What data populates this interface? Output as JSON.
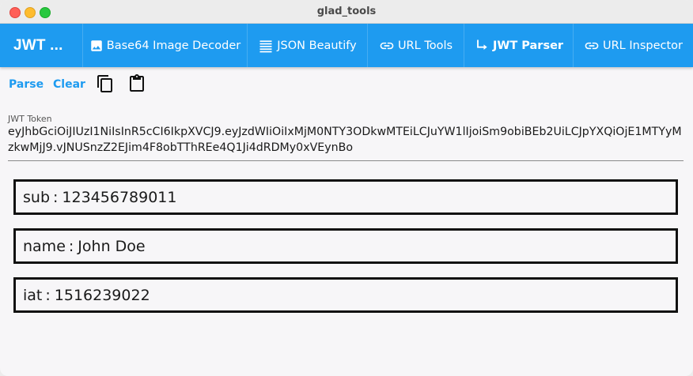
{
  "window": {
    "title": "glad_tools"
  },
  "appbar": {
    "title": "JWT ...",
    "color": "#1e9bf0",
    "tabs": [
      {
        "label": "Base64 Image Decoder",
        "icon": "image-icon"
      },
      {
        "label": "JSON Beautify",
        "icon": "list-icon"
      },
      {
        "label": "URL Tools",
        "icon": "link-icon"
      },
      {
        "label": "JWT Parser",
        "icon": "arrow-turn-right-icon",
        "active": true
      },
      {
        "label": "URL Inspector",
        "icon": "link-icon"
      }
    ]
  },
  "toolbar": {
    "parse_label": "Parse",
    "clear_label": "Clear",
    "copy_icon": "copy-icon",
    "paste_icon": "clipboard-icon"
  },
  "token": {
    "label": "JWT Token",
    "value": "eyJhbGciOiJIUzI1NiIsInR5cCI6IkpXVCJ9.eyJzdWIiOiIxMjM0NTY3ODkwMTEiLCJuYW1lIjoiSm9obiBEb2UiLCJpYXQiOjE1MTYyMzkwMjJ9.vJNUSnzZ2EJim4F8obTThREe4Q1Ji4dRDMy0xVEynBo"
  },
  "claims": [
    {
      "key": "sub",
      "value": "123456789011"
    },
    {
      "key": "name",
      "value": "John Doe"
    },
    {
      "key": "iat",
      "value": "1516239022"
    }
  ]
}
